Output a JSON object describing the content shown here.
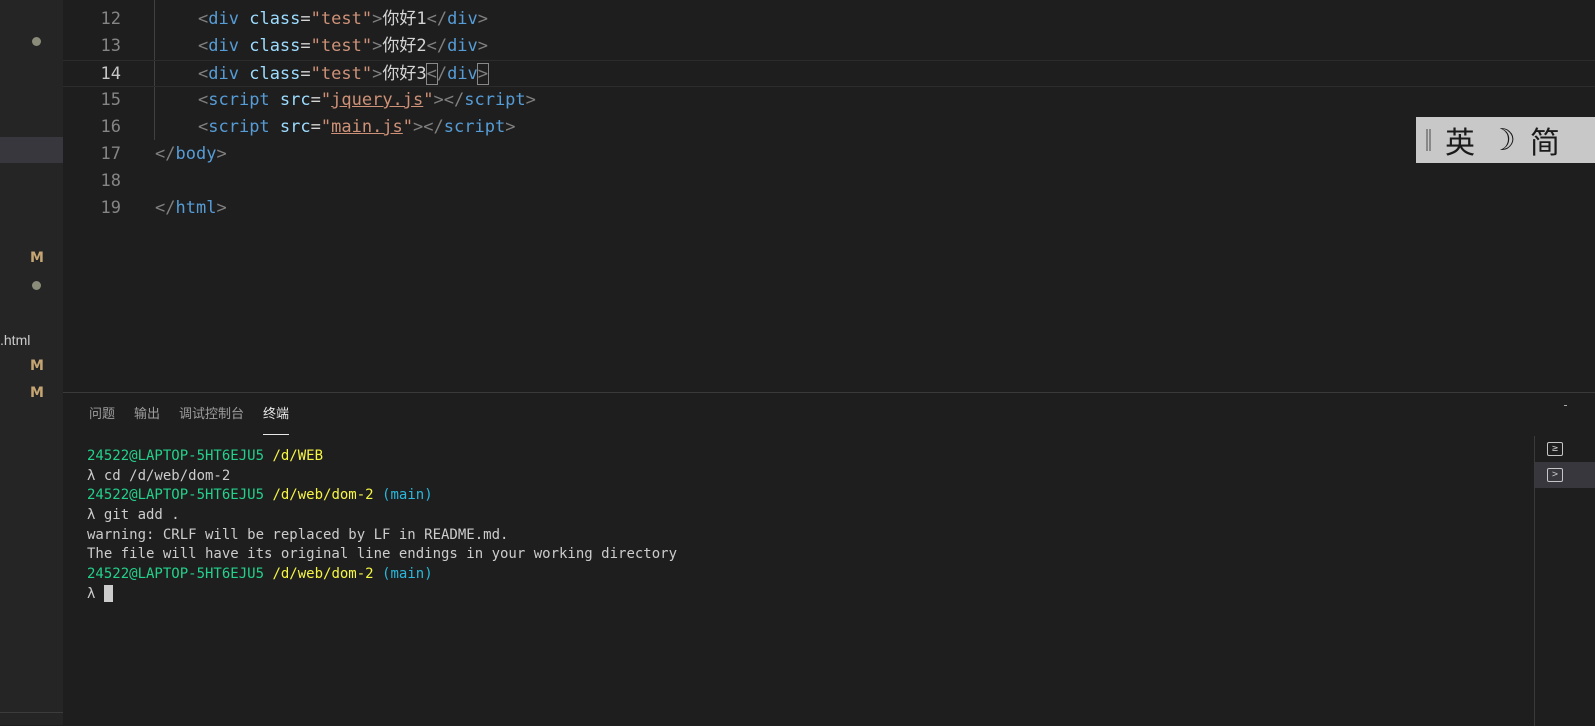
{
  "explorer": {
    "items": [
      {
        "kind": "dot"
      },
      {
        "kind": "mark",
        "text": "M"
      },
      {
        "kind": "dot"
      },
      {
        "kind": "file",
        "text": ".html"
      },
      {
        "kind": "mark",
        "text": "M"
      },
      {
        "kind": "mark",
        "text": "M"
      }
    ]
  },
  "editor": {
    "active_line": "14",
    "lines": [
      {
        "num": "12"
      },
      {
        "num": "13"
      },
      {
        "num": "14"
      },
      {
        "num": "15"
      },
      {
        "num": "16"
      },
      {
        "num": "17"
      },
      {
        "num": "18"
      },
      {
        "num": "19"
      }
    ],
    "code": {
      "l12": {
        "tag": "div",
        "attr": "class",
        "val": "\"test\"",
        "text": "你好1"
      },
      "l13": {
        "tag": "div",
        "attr": "class",
        "val": "\"test\"",
        "text": "你好2"
      },
      "l14": {
        "tag": "div",
        "attr": "class",
        "val": "\"test\"",
        "text": "你好3"
      },
      "l15": {
        "tag": "script",
        "attr": "src",
        "val": "jquery.js"
      },
      "l16": {
        "tag": "script",
        "attr": "src",
        "val": "main.js"
      },
      "l17": {
        "tag": "body"
      },
      "l19": {
        "tag": "html"
      }
    }
  },
  "ime": {
    "lang": "英",
    "mode_icon": "moon-icon",
    "mode_glyph": "☽",
    "charset": "简"
  },
  "panel": {
    "tabs": [
      {
        "label": "问题"
      },
      {
        "label": "输出"
      },
      {
        "label": "调试控制台"
      },
      {
        "label": "终端",
        "active": true
      }
    ]
  },
  "terminal": {
    "lines": [
      {
        "user": "24522@LAPTOP-5HT6EJU5",
        "path": "/d/WEB",
        "branch": ""
      },
      {
        "text": "λ cd /d/web/dom-2"
      },
      {
        "user": "24522@LAPTOP-5HT6EJU5",
        "path": "/d/web/dom-2",
        "branch": "(main)"
      },
      {
        "text": "λ git add ."
      },
      {
        "text": "warning: CRLF will be replaced by LF in README.md."
      },
      {
        "text": "The file will have its original line endings in your working directory"
      },
      {
        "user": "24522@LAPTOP-5HT6EJU5",
        "path": "/d/web/dom-2",
        "branch": "(main)"
      },
      {
        "text": "λ "
      }
    ],
    "instances": [
      {
        "icon": "terminal-icon",
        "glyph": "≥"
      },
      {
        "icon": "terminal-icon",
        "glyph": ">"
      }
    ]
  },
  "colors": {
    "background": "#1e1e1e",
    "prompt_user": "#23d18b",
    "prompt_path": "#f5f543",
    "prompt_branch": "#29b8db"
  }
}
